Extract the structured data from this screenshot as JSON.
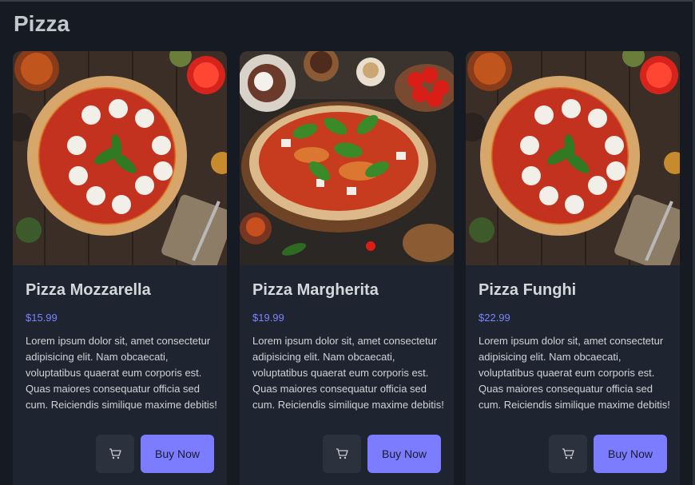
{
  "page": {
    "title": "Pizza"
  },
  "colors": {
    "background": "#161b23",
    "card": "#1e2530",
    "accent": "#7b7cff",
    "price": "#7b84ff"
  },
  "products": [
    {
      "name": "Pizza Mozzarella",
      "price": "$15.99",
      "description": "Lorem ipsum dolor sit, amet consectetur adipisicing elit. Nam obcaecati, voluptatibus quaerat eum corporis est. Quas maiores consequatur officia sed cum. Reiciendis similique maxime debitis!",
      "image_icon": "pizza-mozzarella-photo",
      "cart_icon": "cart-icon",
      "buy_label": "Buy Now"
    },
    {
      "name": "Pizza Margherita",
      "price": "$19.99",
      "description": "Lorem ipsum dolor sit, amet consectetur adipisicing elit. Nam obcaecati, voluptatibus quaerat eum corporis est. Quas maiores consequatur officia sed cum. Reiciendis similique maxime debitis!",
      "image_icon": "pizza-margherita-photo",
      "cart_icon": "cart-icon",
      "buy_label": "Buy Now"
    },
    {
      "name": "Pizza Funghi",
      "price": "$22.99",
      "description": "Lorem ipsum dolor sit, amet consectetur adipisicing elit. Nam obcaecati, voluptatibus quaerat eum corporis est. Quas maiores consequatur officia sed cum. Reiciendis similique maxime debitis!",
      "image_icon": "pizza-funghi-photo",
      "cart_icon": "cart-icon",
      "buy_label": "Buy Now"
    }
  ]
}
